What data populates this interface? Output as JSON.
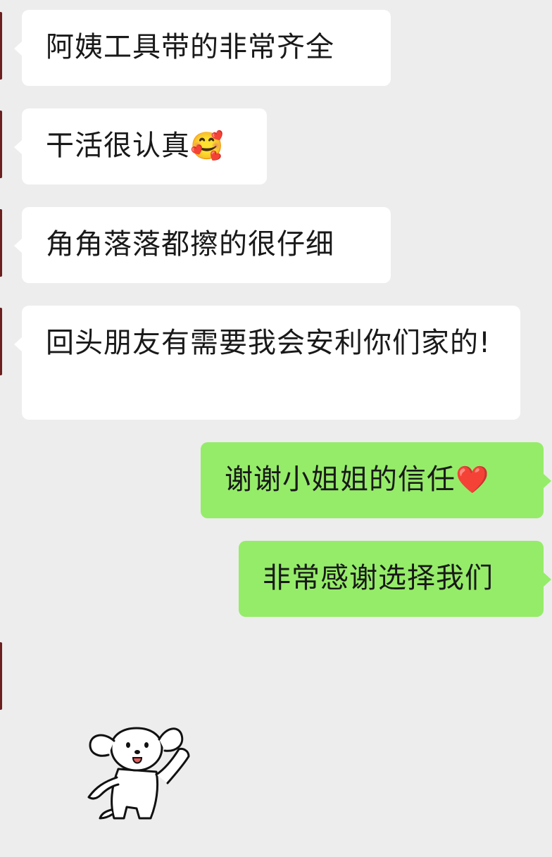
{
  "messages": [
    {
      "side": "left",
      "text": "阿姨工具带的非常齐全"
    },
    {
      "side": "left",
      "text": "干活很认真",
      "emoji": "🥰"
    },
    {
      "side": "left",
      "text": "角角落落都擦的很仔细"
    },
    {
      "side": "left",
      "text": "回头朋友有需要我会安利你们家的!"
    },
    {
      "side": "right",
      "text": "谢谢小姐姐的信任",
      "emoji": "❤️"
    },
    {
      "side": "right",
      "text": "非常感谢选择我们"
    }
  ],
  "sticker": {
    "icon": "koala-waving-sticker-icon"
  },
  "colors": {
    "background": "#ededed",
    "incoming": "#ffffff",
    "outgoing": "#95ec69"
  }
}
